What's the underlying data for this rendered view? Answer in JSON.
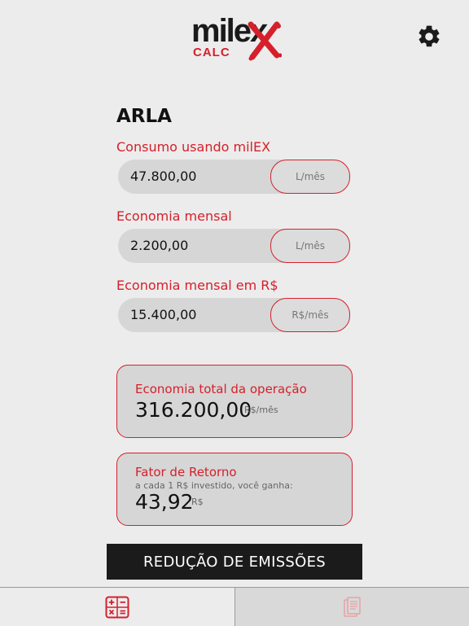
{
  "app": {
    "logo_text": "milex",
    "logo_sub": "CALC"
  },
  "section": {
    "title": "ARLA"
  },
  "fields": [
    {
      "label": "Consumo usando milEX",
      "value": "47.800,00",
      "unit": "L/mês"
    },
    {
      "label": "Economia mensal",
      "value": "2.200,00",
      "unit": "L/mês"
    },
    {
      "label": "Economia mensal em R$",
      "value": "15.400,00",
      "unit": "R$/mês"
    }
  ],
  "cards": {
    "total": {
      "title": "Economia total da operação",
      "value": "316.200,00",
      "unit": "R$/mês"
    },
    "retorno": {
      "title": "Fator de Retorno",
      "subtitle": "a cada 1 R$ investido, você ganha:",
      "value": "43,92",
      "unit": "R$"
    }
  },
  "actions": {
    "emissoes_label": "REDUÇÃO DE EMISSÕES"
  },
  "icons": {
    "settings": "gear-icon",
    "tab_calculator": "calculator-icon",
    "tab_reports": "documents-icon"
  },
  "colors": {
    "accent": "#d5202b",
    "background": "#ececec",
    "field": "#d6d6d6",
    "button": "#1b1b1b"
  }
}
